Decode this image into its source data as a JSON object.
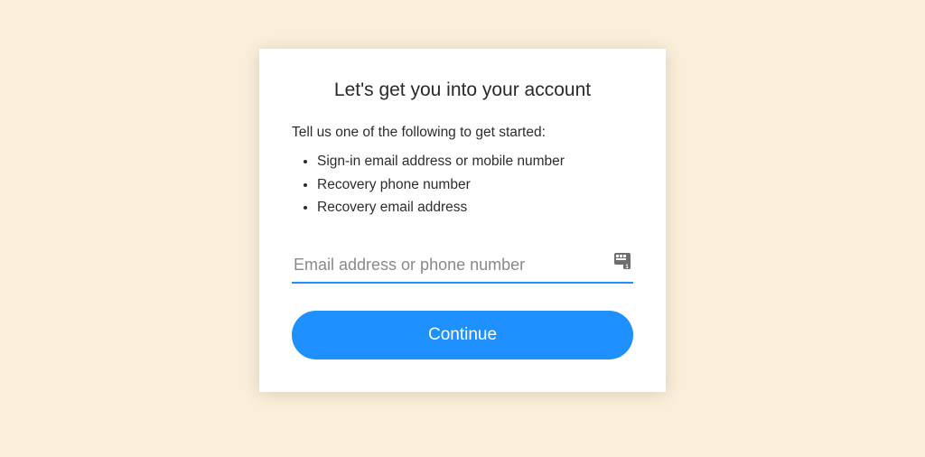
{
  "card": {
    "title": "Let's get you into your account",
    "prompt": "Tell us one of the following to get started:",
    "options": [
      "Sign-in email address or mobile number",
      "Recovery phone number",
      "Recovery email address"
    ],
    "input": {
      "placeholder": "Email address or phone number",
      "value": ""
    },
    "continue_label": "Continue"
  },
  "colors": {
    "background": "#faf0da",
    "card_bg": "#ffffff",
    "accent": "#1e90ff",
    "text": "#2d2d2d",
    "placeholder": "#8a8a8a"
  }
}
